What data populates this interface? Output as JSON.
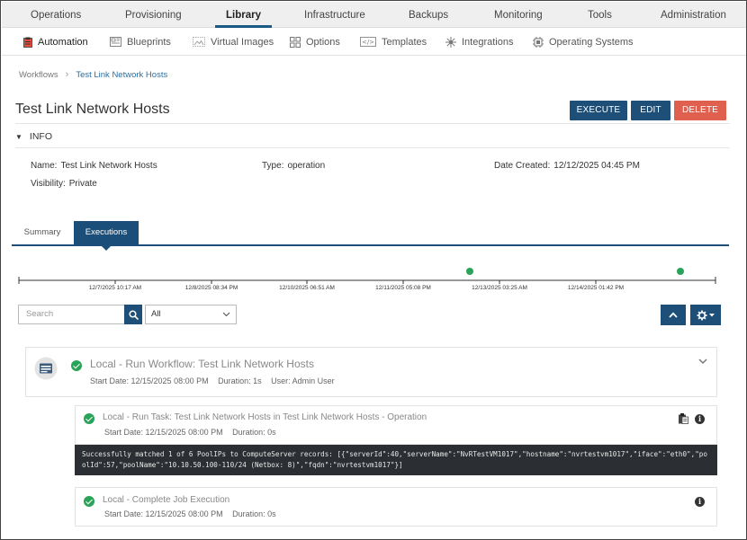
{
  "topnav": {
    "items": [
      "Operations",
      "Provisioning",
      "Library",
      "Infrastructure",
      "Backups",
      "Monitoring",
      "Tools",
      "Administration"
    ],
    "active": "Library"
  },
  "subnav": {
    "items": [
      "Automation",
      "Blueprints",
      "Virtual Images",
      "Options",
      "Templates",
      "Integrations",
      "Operating Systems"
    ],
    "icons": [
      "clipboard-icon",
      "blueprint-icon",
      "virtual-images-icon",
      "options-icon",
      "templates-icon",
      "integrations-icon",
      "operating-systems-icon"
    ],
    "active": "Automation"
  },
  "breadcrumb": {
    "parent": "Workflows",
    "current": "Test Link Network Hosts"
  },
  "page": {
    "title": "Test Link Network Hosts"
  },
  "actions": {
    "execute": "EXECUTE",
    "edit": "EDIT",
    "delete": "DELETE"
  },
  "info": {
    "section_label": "INFO",
    "name_label": "Name:",
    "name_value": "Test Link Network Hosts",
    "type_label": "Type:",
    "type_value": "operation",
    "date_label": "Date Created:",
    "date_value": "12/12/2025 04:45 PM",
    "visibility_label": "Visibility:",
    "visibility_value": "Private"
  },
  "tabs": {
    "summary": "Summary",
    "executions": "Executions",
    "active": "Executions"
  },
  "timeline": {
    "labels": [
      "12/7/2025 10:17 AM",
      "12/8/2025 08:34 PM",
      "12/10/2025 06:51 AM",
      "12/11/2025 05:08 PM",
      "12/13/2025 03:25 AM",
      "12/14/2025 01:42 PM"
    ],
    "point_color": "#2aa35a"
  },
  "filters": {
    "search_placeholder": "Search",
    "select_value": "All"
  },
  "executions": {
    "main": {
      "title": "Local - Run Workflow: Test Link Network Hosts",
      "start_date": "Start Date: 12/15/2025 08:00 PM",
      "duration": "Duration: 1s",
      "user": "User: Admin User"
    },
    "task": {
      "title": "Local - Run Task: Test Link Network Hosts in Test Link Network Hosts - Operation",
      "start_date": "Start Date: 12/15/2025 08:00 PM",
      "duration": "Duration: 0s",
      "output": "Successfully matched 1 of 6 PoolIPs to ComputeServer records: [{\"serverId\":40,\"serverName\":\"NvRTestVM1017\",\"hostname\":\"nvrtestvm1017\",\"iface\":\"eth0\",\"poolId\":57,\"poolName\":\"10.10.50.100-110/24 (Netbox: 8)\",\"fqdn\":\"nvrtestvm1017\"}]"
    },
    "complete": {
      "title": "Local - Complete Job Execution",
      "start_date": "Start Date: 12/15/2025 08:00 PM",
      "duration": "Duration: 0s"
    }
  },
  "colors": {
    "primary": "#1d4f78",
    "danger": "#e06050",
    "success": "#2aa35a"
  }
}
